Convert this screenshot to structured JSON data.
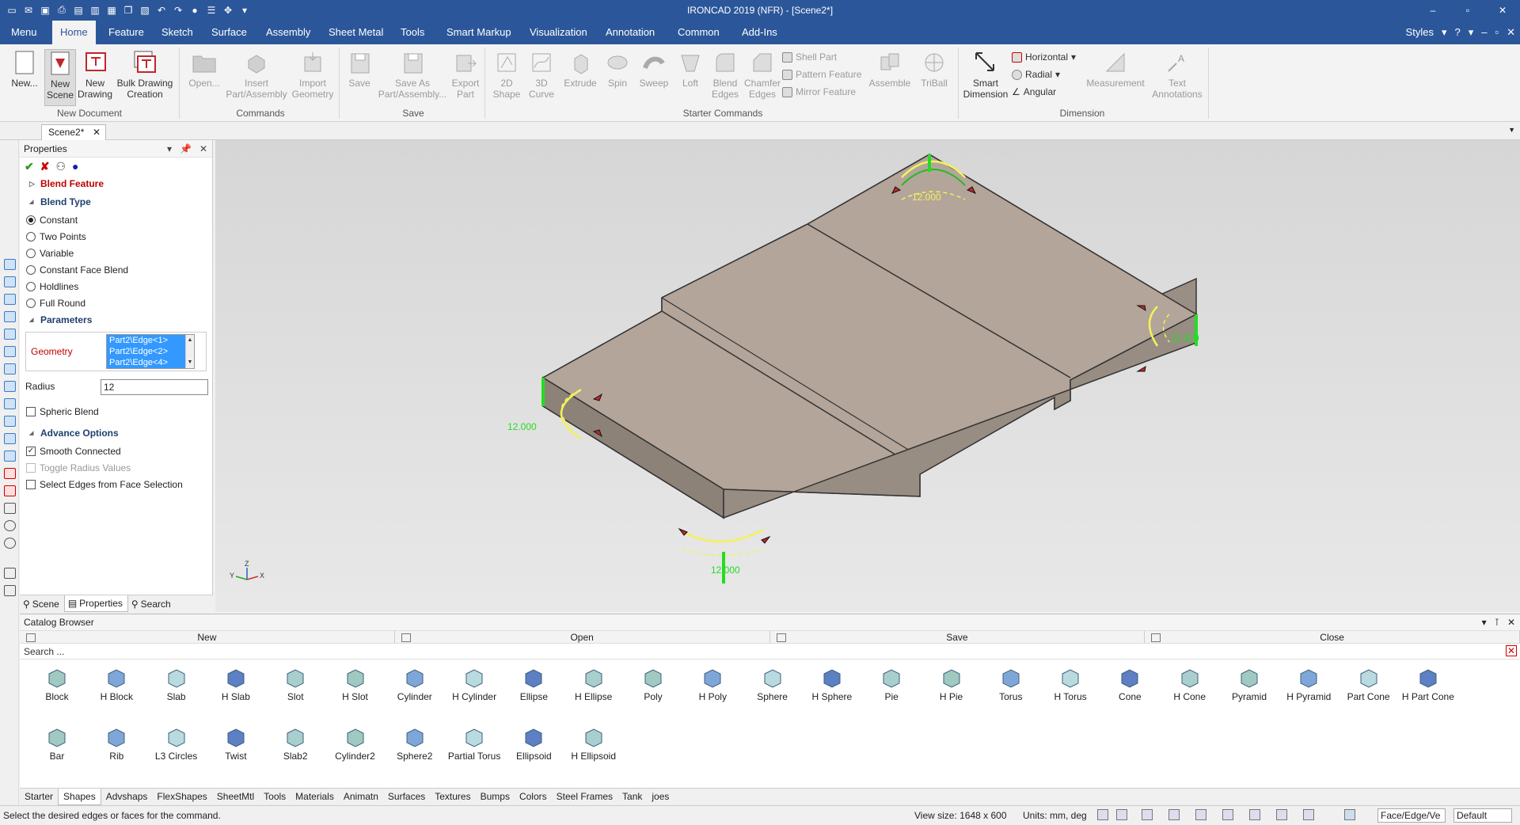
{
  "app": {
    "title": "IRONCAD 2019 (NFR) - [Scene2*]",
    "accent": "#2b579a",
    "window_controls": [
      "–",
      "▫",
      "✕"
    ]
  },
  "quick_access": [
    "new-icon",
    "mail-icon",
    "save-icon",
    "print-icon",
    "folder-icon",
    "save-as-icon",
    "grid-icon",
    "copy-icon",
    "paste-icon",
    "undo-icon",
    "redo-icon",
    "sphere-icon",
    "menu-icon",
    "transform-icon",
    "list-icon"
  ],
  "menu": {
    "tabs": [
      "Menu",
      "Home",
      "Feature",
      "Sketch",
      "Surface",
      "Assembly",
      "Sheet Metal",
      "Tools",
      "Smart Markup",
      "Visualization",
      "Annotation",
      "Common",
      "Add-Ins"
    ],
    "active": "Home",
    "styles": "Styles",
    "right_icons": [
      "▾",
      "?",
      "▾",
      "–",
      "▫",
      "✕"
    ]
  },
  "ribbon": {
    "buttons": [
      {
        "label": "New...",
        "enabled": true
      },
      {
        "label": "New Scene",
        "enabled": true
      },
      {
        "label": "New Drawing",
        "enabled": true
      },
      {
        "label": "Bulk Drawing Creation",
        "enabled": true
      },
      {
        "label": "Open...",
        "enabled": false
      },
      {
        "label": "Insert Part/Assembly",
        "enabled": false
      },
      {
        "label": "Import Geometry",
        "enabled": false
      },
      {
        "label": "Save",
        "enabled": false
      },
      {
        "label": "Save As Part/Assembly...",
        "enabled": false
      },
      {
        "label": "Export Part",
        "enabled": false
      },
      {
        "label": "2D Shape",
        "enabled": false
      },
      {
        "label": "3D Curve",
        "enabled": false
      },
      {
        "label": "Extrude",
        "enabled": false
      },
      {
        "label": "Spin",
        "enabled": false
      },
      {
        "label": "Sweep",
        "enabled": false
      },
      {
        "label": "Loft",
        "enabled": false
      },
      {
        "label": "Blend Edges",
        "enabled": false
      },
      {
        "label": "Chamfer Edges",
        "enabled": false
      },
      {
        "label": "Assemble",
        "enabled": false
      },
      {
        "label": "TriBall",
        "enabled": false
      },
      {
        "label": "Smart Dimension",
        "enabled": true
      },
      {
        "label": "Measurement",
        "enabled": false
      },
      {
        "label": "Text Annotations",
        "enabled": false
      }
    ],
    "small": {
      "shell_part": "Shell Part",
      "pattern_feature": "Pattern Feature",
      "mirror_feature": "Mirror Feature",
      "horizontal": "Horizontal",
      "radial": "Radial",
      "angular": "Angular"
    },
    "groups": {
      "new_document": "New Document",
      "commands": "Commands",
      "save": "Save",
      "starter_commands": "Starter Commands",
      "dimension": "Dimension"
    }
  },
  "doc_tab": {
    "label": "Scene2*",
    "close": "✕"
  },
  "properties": {
    "title": "Properties",
    "header_icons": [
      "▾",
      "📌",
      "✕"
    ],
    "feature": "Blend Feature",
    "blend_type": {
      "title": "Blend Type",
      "options": [
        "Constant",
        "Two Points",
        "Variable",
        "Constant Face Blend",
        "Holdlines",
        "Full Round"
      ],
      "selected": "Constant"
    },
    "parameters": {
      "title": "Parameters",
      "geometry_label": "Geometry",
      "geometry_items": [
        "Part2\\Edge<1>",
        "Part2\\Edge<2>",
        "Part2\\Edge<4>"
      ],
      "radius_label": "Radius",
      "radius_value": "12",
      "spheric_blend": "Spheric Blend"
    },
    "advance": {
      "title": "Advance Options",
      "smooth_connected": "Smooth Connected",
      "toggle_radius": "Toggle Radius Values",
      "select_edges": "Select Edges from Face Selection"
    },
    "tabs": [
      "Scene",
      "Properties",
      "Search"
    ],
    "active_tab": "Properties"
  },
  "viewport": {
    "dims": [
      "12.000",
      "12.000",
      "12.000",
      "12.000"
    ],
    "axis": {
      "z": "Z",
      "x": "X",
      "y": "Y"
    },
    "part_color": "#b3a59a",
    "highlight_color": "#22dd22",
    "blend_color": "#f2f25a"
  },
  "catalog": {
    "title": "Catalog Browser",
    "buttons": [
      "New",
      "Open",
      "Save",
      "Close"
    ],
    "search_placeholder": "Search ...",
    "row1": [
      "Block",
      "H Block",
      "Slab",
      "H Slab",
      "Slot",
      "H Slot",
      "Cylinder",
      "H Cylinder",
      "Ellipse",
      "H Ellipse",
      "Poly",
      "H Poly",
      "Sphere",
      "H Sphere",
      "Pie",
      "H Pie",
      "Torus",
      "H Torus",
      "Cone",
      "H Cone",
      "Pyramid",
      "H Pyramid",
      "Part Cone",
      "H Part Cone"
    ],
    "row2": [
      "Bar",
      "Rib",
      "L3 Circles",
      "Twist",
      "Slab2",
      "Cylinder2",
      "Sphere2",
      "Partial Torus",
      "Ellipsoid",
      "H Ellipsoid"
    ],
    "tabs": [
      "Starter",
      "Shapes",
      "Advshaps",
      "FlexShapes",
      "SheetMtl",
      "Tools",
      "Materials",
      "Animatn",
      "Surfaces",
      "Textures",
      "Bumps",
      "Colors",
      "Steel Frames",
      "Tank",
      "joes"
    ],
    "active_tab": "Shapes"
  },
  "status": {
    "message": "Select the desired edges or faces for the command.",
    "view_size": "View size: 1648 x  600",
    "units": "Units: mm, deg",
    "selection_filter": "Face/Edge/Ve",
    "style": "Default"
  }
}
